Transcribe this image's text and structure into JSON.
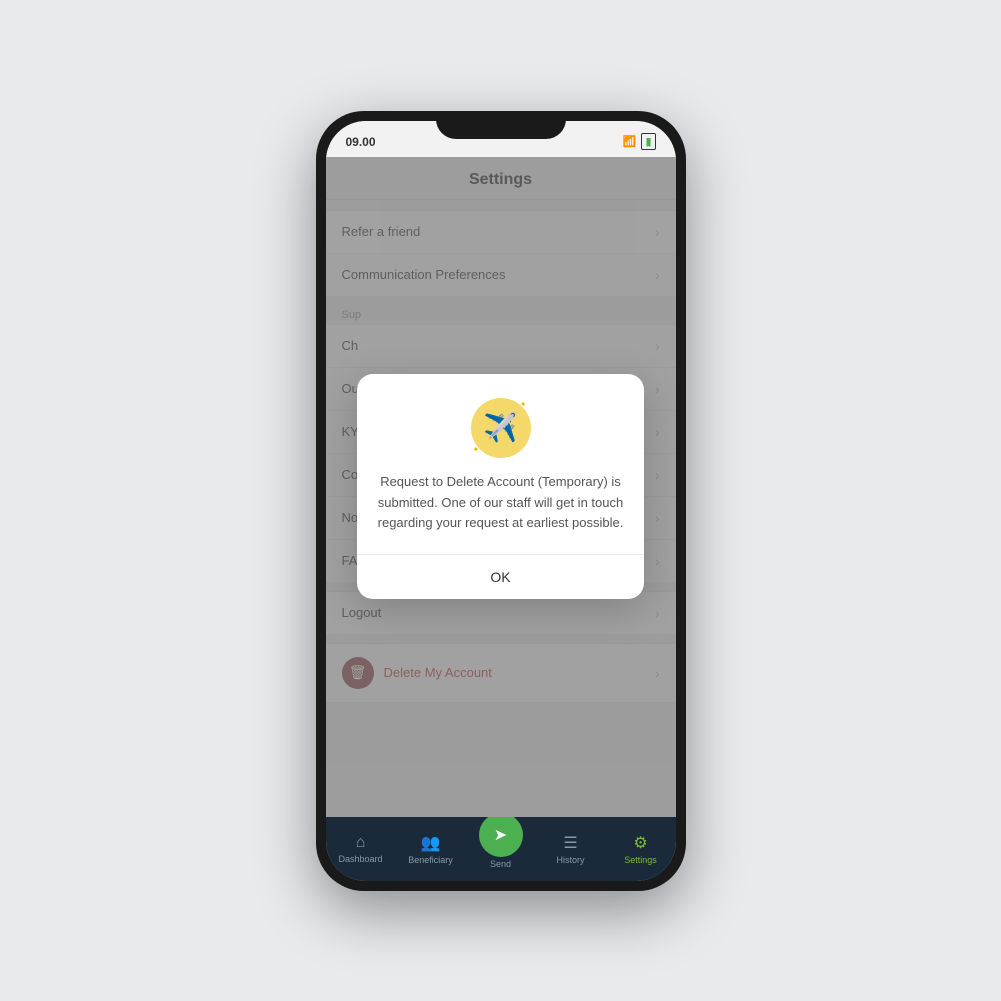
{
  "phone": {
    "status_bar": {
      "time": "09.00",
      "wifi_label": "wifi",
      "battery_label": "battery"
    },
    "settings_screen": {
      "title": "Settings",
      "sections": [
        {
          "items": [
            {
              "label": "Refer a friend"
            },
            {
              "label": "Communication Preferences"
            }
          ]
        },
        {
          "section_label": "Sup",
          "items": [
            {
              "label": "Ch"
            },
            {
              "label": "Ou"
            },
            {
              "label": "KY"
            },
            {
              "label": "Co"
            },
            {
              "label": "No"
            },
            {
              "label": "FA"
            }
          ]
        },
        {
          "items": [
            {
              "label": "Logout"
            }
          ]
        }
      ],
      "delete_account": {
        "label": "Delete My Account"
      }
    },
    "bottom_nav": {
      "items": [
        {
          "label": "Dashboard",
          "icon": "⌂",
          "active": false
        },
        {
          "label": "Beneficiary",
          "icon": "👥",
          "active": false
        },
        {
          "label": "Send",
          "icon": "➤",
          "active": false,
          "is_send": true
        },
        {
          "label": "History",
          "icon": "☰",
          "active": false
        },
        {
          "label": "Settings",
          "icon": "⚙",
          "active": true
        }
      ]
    },
    "modal": {
      "message": "Request to Delete Account (Temporary) is submitted. One of our staff will get in touch regarding your request at earliest possible.",
      "ok_label": "OK"
    }
  }
}
